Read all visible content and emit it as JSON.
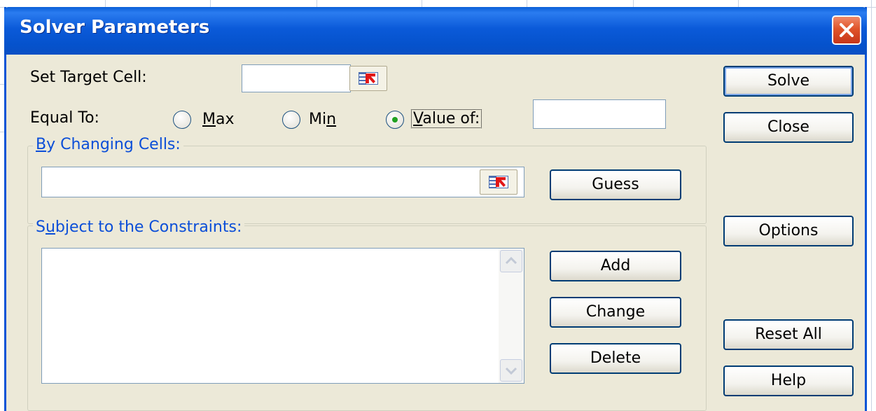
{
  "window": {
    "title": "Solver Parameters"
  },
  "target_cell": {
    "label": "Set Target Cell:",
    "value": ""
  },
  "equal_to": {
    "label": "Equal To:",
    "options": [
      {
        "label": "Max",
        "accel": "M",
        "selected": false
      },
      {
        "label": "Min",
        "accel": "n",
        "selected": false
      },
      {
        "label": "Value of:",
        "accel": "V",
        "selected": true
      }
    ],
    "value_of": ""
  },
  "changing_cells": {
    "label": "By Changing Cells:",
    "value": ""
  },
  "constraints": {
    "label": "Subject to the Constraints:",
    "items": []
  },
  "buttons": {
    "solve": "Solve",
    "close": "Close",
    "guess": "Guess",
    "options": "Options",
    "add": "Add",
    "change": "Change",
    "delete": "Delete",
    "reset_all": "Reset All",
    "help": "Help"
  },
  "colors": {
    "titlebar": "#0b5ad9",
    "dialog_bg": "#ece9d8",
    "group_label": "#0b4ed8",
    "close_button": "#e0542a"
  }
}
